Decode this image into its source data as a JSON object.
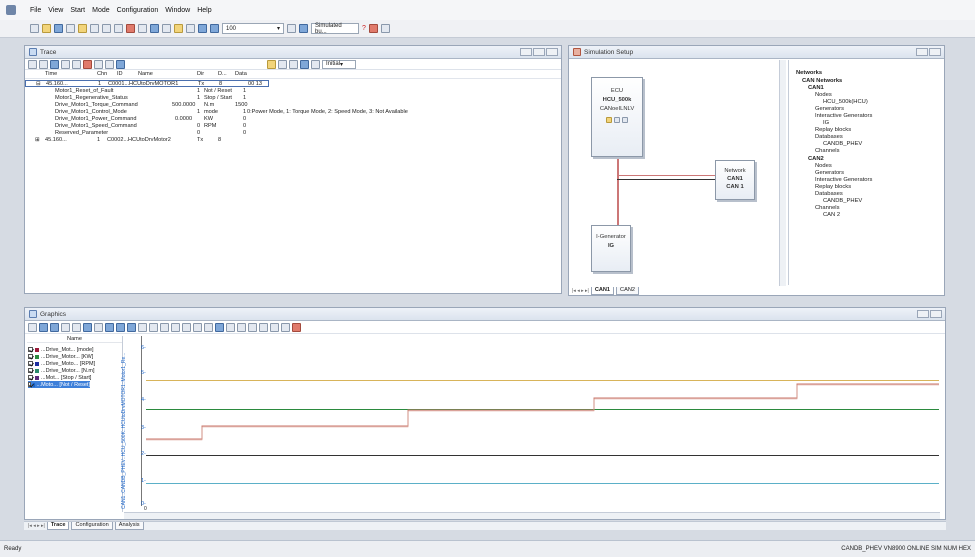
{
  "menu": [
    "File",
    "View",
    "Start",
    "Mode",
    "Configuration",
    "Window",
    "Help"
  ],
  "toolbar": {
    "zoom": "100",
    "sim_mode": "Simulated bu..."
  },
  "trace": {
    "title": "Trace",
    "filter": "Initial",
    "headers": [
      "Time",
      "Chn",
      "ID",
      "Name",
      "Dir",
      "D...",
      "Data"
    ],
    "rows": [
      {
        "time": "45.160...",
        "chn": "1",
        "id": "C0001...",
        "name": "HCUtoDrvMOTOR1",
        "dir": "Tx",
        "dlc": "8",
        "data": "00  13"
      },
      {
        "name": "Motor1_Reset_of_Fault",
        "raw": "1",
        "phys": "Not / Reset",
        "val": "1"
      },
      {
        "name": "Motor1_Regenerative_Status",
        "raw": "1",
        "phys": "Stop / Start",
        "val": "1"
      },
      {
        "name": "Drive_Motor1_Torque_Command",
        "raw": "500.0000",
        "phys": "N.m",
        "val": "1500"
      },
      {
        "name": "Drive_Motor1_Control_Mode",
        "raw": "1",
        "phys": "mode",
        "val": "1",
        "desc": "0:Power Mode, 1: Torque Mode, 2: Speed Mode, 3: Not Available"
      },
      {
        "name": "Drive_Motor1_Power_Command",
        "raw": "0.0000",
        "phys": "KW",
        "val": "0"
      },
      {
        "name": "Drive_Motor1_Speed_Command",
        "raw": "0",
        "phys": "RPM",
        "val": "0"
      },
      {
        "name": "Reserved_Parameter",
        "raw": "0",
        "phys": "",
        "val": "0"
      },
      {
        "time": "45.160...",
        "chn": "1",
        "id": "C0002...",
        "name": "HCUtoDrvMotor2",
        "dir": "Tx",
        "dlc": "8",
        "data": ""
      }
    ]
  },
  "sim": {
    "title": "Simulation Setup",
    "ecu": {
      "l1": "ECU",
      "l2": "HCU_500k",
      "l3": "CANoeILNLV"
    },
    "network": {
      "l1": "Network",
      "l2": "CAN1",
      "l3": "CAN 1"
    },
    "gen": {
      "l1": "I-Generator",
      "l2": "IG"
    },
    "tabs": [
      "CAN1",
      "CAN2"
    ],
    "tree": [
      "Networks",
      "CAN Networks",
      "CAN1",
      "Nodes",
      "HCU_500k(HCU)",
      "Generators",
      "Interactive Generators",
      "IG",
      "Replay blocks",
      "Databases",
      "CANDB_PHEV",
      "Channels",
      "CAN2",
      "Nodes",
      "Generators",
      "Interactive Generators",
      "Replay blocks",
      "Databases",
      "CANDB_PHEV",
      "Channels",
      "CAN 2"
    ]
  },
  "graphics": {
    "title": "Graphics",
    "legend_header": "Name",
    "legend": [
      {
        "label": "...Drive_Mot... [mode]",
        "color": "#9b1b3a"
      },
      {
        "label": "...Drive_Motor... [KW]",
        "color": "#2b8a3e"
      },
      {
        "label": "...Drive_Moto... [RPM]",
        "color": "#1f2fa0"
      },
      {
        "label": "...Drive_Motor... [N.m]",
        "color": "#2a8a6a"
      },
      {
        "label": "...Mot... [Stop / Start]",
        "color": "#5b2a7a"
      },
      {
        "label": "...Moto... [Not / Reset]",
        "color": "#1b64c8",
        "selected": true
      }
    ],
    "axis_label": "CAN1::CANDB_PHEV::HCU_500K::HCUtoDrvMOTOR1::Motor1_Re...",
    "yticks": [
      "6-",
      "5-",
      "4-",
      "3-",
      "2-",
      "1-",
      "0-"
    ],
    "xtick": "0"
  },
  "bottom_tabs": [
    "Trace",
    "Configuration",
    "Analysis"
  ],
  "status": {
    "left": "Ready",
    "right": "CANDB_PHEV  VN8900  ONLINE  SIM  NUM  HEX"
  }
}
